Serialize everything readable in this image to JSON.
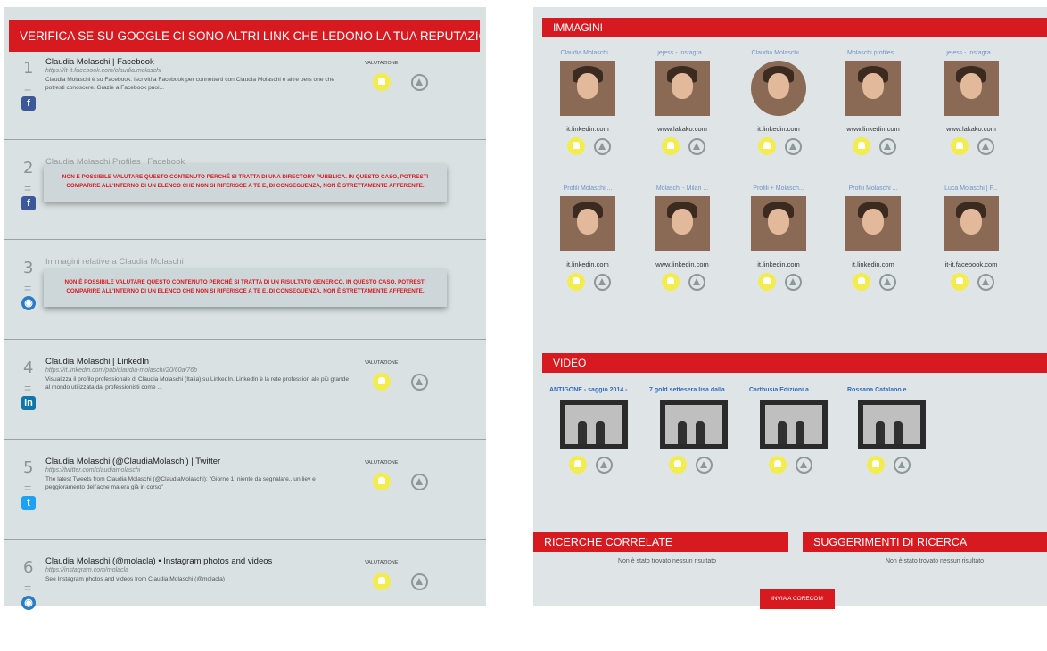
{
  "left": {
    "header": "VERIFICA SE SU GOOGLE CI SONO ALTRI LINK CHE LEDONO LA TUA REPUTAZIONE",
    "valutazione_label": "VALUTAZIONE",
    "results": [
      {
        "num": "1",
        "eq": "=",
        "icon": "facebook-icon",
        "icon_glyph": "f",
        "title": "Claudia Molaschi | Facebook",
        "url": "https://it-it.facebook.com/claudia.molaschi",
        "desc": "Claudia Molaschi è su Facebook. Iscriviti a Facebook per connetterti con Claudia Molaschi e altre pers one che potresti conoscere. Grazie a Facebook puoi..."
      },
      {
        "num": "2",
        "eq": "=",
        "icon": "facebook-icon",
        "icon_glyph": "f",
        "title": "Claudia Molaschi Profiles | Facebook",
        "warning": "NON È POSSIBILE VALUTARE QUESTO CONTENUTO PERCHÉ SI TRATTA DI UNA DIRECTORY PUBBLICA. IN QUESTO CASO, POTRESTI COMPARIRE ALL'INTERNO DI UN ELENCO CHE NON SI RIFERISCE A TE E, DI CONSEGUENZA, NON È STRETTAMENTE AFFERENTE."
      },
      {
        "num": "3",
        "eq": "=",
        "icon": "globe-icon",
        "icon_glyph": "◉",
        "title": "Immagini relative a Claudia Molaschi",
        "warning": "NON È POSSIBILE VALUTARE QUESTO CONTENUTO PERCHÉ SI TRATTA DI UN RISULTATO GENERICO. IN QUESTO CASO, POTRESTI COMPARIRE ALL'INTERNO DI UN ELENCO CHE NON SI RIFERISCE A TE E, DI CONSEGUENZA, NON È STRETTAMENTE AFFERENTE."
      },
      {
        "num": "4",
        "eq": "=",
        "icon": "linkedin-icon",
        "icon_glyph": "in",
        "title": "Claudia Molaschi | LinkedIn",
        "url": "https://it.linkedin.com/pub/claudia-molaschi/20/60a/76b",
        "desc": "Visualizza il profilo professionale di Claudia Molaschi (Italia) su LinkedIn. LinkedIn è la rete profession ale più grande al mondo utilizzata dai professionisti come ..."
      },
      {
        "num": "5",
        "eq": "=",
        "icon": "twitter-icon",
        "icon_glyph": "t",
        "title": "Claudia Molaschi (@ClaudiaMolaschi) | Twitter",
        "url": "https://twitter.com/claudiamolaschi",
        "desc": "The latest Tweets from Claudia Molaschi (@ClaudiaMolaschi): \"Giorno 1: niente da segnalare...un liev e peggioramento dell'acne ma era già in corso\""
      },
      {
        "num": "6",
        "eq": "=",
        "icon": "globe-icon",
        "icon_glyph": "◉",
        "title": "Claudia Molaschi (@molacla) • Instagram photos and videos",
        "url": "https://instagram.com/molacla",
        "desc": "See Instagram photos and videos from Claudia Molaschi (@molacla)"
      }
    ]
  },
  "right": {
    "images_header": "IMMAGINI",
    "images": [
      {
        "label": "Claudia Molaschi ...",
        "domain": "it.linkedin.com",
        "round": false
      },
      {
        "label": "jejess - Instagra...",
        "domain": "www.lakako.com",
        "round": false
      },
      {
        "label": "Claudia Molaschi ...",
        "domain": "it.linkedin.com",
        "round": true
      },
      {
        "label": "Molaschi profiles...",
        "domain": "www.linkedin.com",
        "round": false
      },
      {
        "label": "jejess - Instagra...",
        "domain": "www.lakako.com",
        "round": false
      },
      {
        "label": "Profili Molaschi ...",
        "domain": "it.linkedin.com",
        "round": false
      },
      {
        "label": "Molaschi - Milan ...",
        "domain": "www.linkedin.com",
        "round": false
      },
      {
        "label": "Profili + Molasch...",
        "domain": "it.linkedin.com",
        "round": false
      },
      {
        "label": "Profili Molaschi ...",
        "domain": "it.linkedin.com",
        "round": false
      },
      {
        "label": "Luca Molaschi | F...",
        "domain": "it-it.facebook.com",
        "round": false
      }
    ],
    "video_header": "VIDEO",
    "videos": [
      {
        "label": "ANTIGONE - saggio 2014 -"
      },
      {
        "label": "7 gold settesera lisa dalla"
      },
      {
        "label": "Carthusia Edizioni a"
      },
      {
        "label": "Rossana Catalano e"
      }
    ],
    "related_header": "RICERCHE CORRELATE",
    "suggest_header": "SUGGERIMENTI DI RICERCA",
    "no_result": "Non è stato trovato nessun risultato",
    "send_button": "INVIA A CORECOM"
  }
}
